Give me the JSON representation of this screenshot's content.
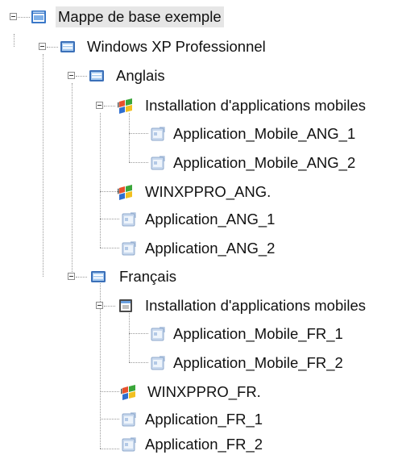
{
  "tree": {
    "root": {
      "label": "Mappe de base exemple"
    },
    "os": {
      "label": "Windows XP Professionnel"
    },
    "lang_en": {
      "label": "Anglais",
      "mobile_install": {
        "label": "Installation d'applications mobiles",
        "apps": [
          "Application_Mobile_ANG_1",
          "Application_Mobile_ANG_2"
        ]
      },
      "winxp": "WINXPPRO_ANG.",
      "apps": [
        "Application_ANG_1",
        "Application_ANG_2"
      ]
    },
    "lang_fr": {
      "label": "Français",
      "mobile_install": {
        "label": "Installation d'applications mobiles",
        "apps": [
          "Application_Mobile_FR_1",
          "Application_Mobile_FR_2"
        ]
      },
      "winxp": "WINXPPRO_FR.",
      "apps": [
        "Application_FR_1",
        "Application_FR_2"
      ]
    }
  }
}
